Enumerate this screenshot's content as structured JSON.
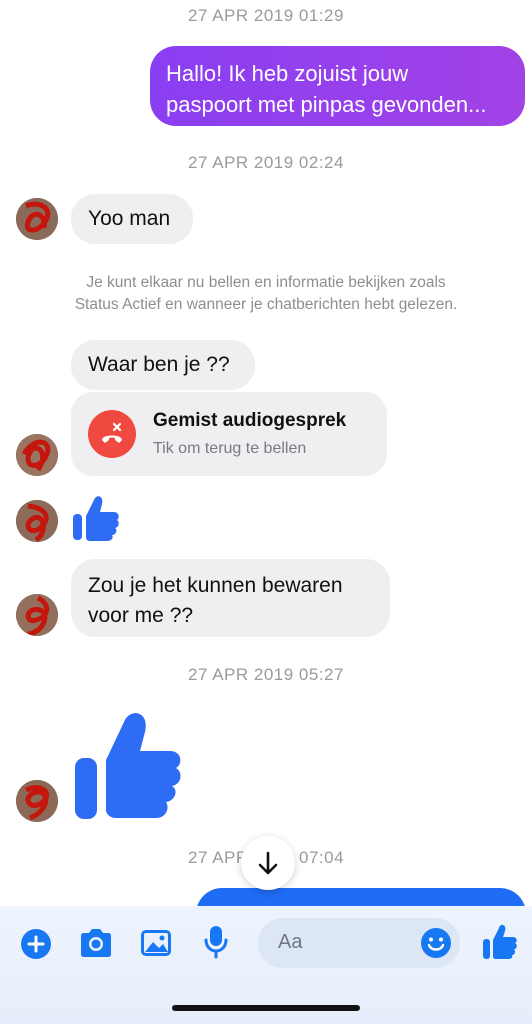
{
  "timestamps": [
    "27 APR 2019 01:29",
    "27 APR 2019 02:24",
    "27 APR 2019 05:27"
  ],
  "last_timestamp": {
    "left": "27 APR",
    "right": "07:04"
  },
  "messages": {
    "outgoing_1": [
      "Hallo! Ik heb zojuist jouw",
      "paspoort met pinpas gevonden..."
    ],
    "incoming_1": "Yoo man",
    "incoming_2": "Waar ben je ??",
    "incoming_3": [
      "Zou je het kunnen bewaren",
      "voor me ??"
    ]
  },
  "info_notice": [
    "Je kunt elkaar nu bellen en informatie bekijken zoals",
    "Status Actief en wanneer je chatberichten hebt gelezen."
  ],
  "missed_call": {
    "title": "Gemist audiogesprek",
    "subtitle": "Tik om terug te bellen"
  },
  "composer": {
    "placeholder": "Aa"
  },
  "icons": [
    "plus-icon",
    "camera-icon",
    "gallery-icon",
    "microphone-icon",
    "emoji-icon",
    "thumbs-up-icon",
    "scroll-down-arrow-icon"
  ],
  "colors": {
    "outgoing_gradient_start": "#8a3ef2",
    "outgoing_gradient_end": "#a03fe8",
    "outgoing_blue": "#1f6cf5",
    "missed_call_red": "#f0493f",
    "messenger_blue": "#1877f2",
    "like_blue": "#2f6cf6"
  }
}
